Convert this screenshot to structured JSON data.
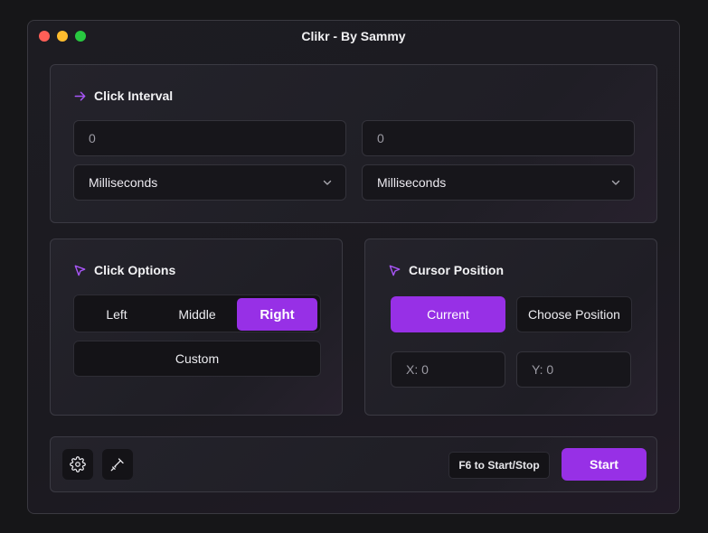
{
  "window": {
    "title": "Clikr - By Sammy"
  },
  "click_interval": {
    "heading": "Click Interval",
    "left": {
      "value": "0",
      "unit": "Milliseconds"
    },
    "right": {
      "value": "0",
      "unit": "Milliseconds"
    }
  },
  "click_options": {
    "heading": "Click Options",
    "buttons": [
      "Left",
      "Middle",
      "Right"
    ],
    "selected": "Right",
    "custom_label": "Custom"
  },
  "cursor_position": {
    "heading": "Cursor Position",
    "current_label": "Current",
    "choose_label": "Choose Position",
    "x_placeholder": "X: 0",
    "y_placeholder": "Y: 0"
  },
  "footer": {
    "hotkey_label": "F6 to Start/Stop",
    "start_label": "Start"
  },
  "colors": {
    "accent": "#9730e6",
    "accent_icon": "#a855f7"
  },
  "icons": {
    "interval": "arrow-right-icon",
    "options": "cursor-pointer-icon",
    "position": "cursor-pointer-icon",
    "settings": "gear-icon",
    "tool": "pen-tool-icon"
  }
}
